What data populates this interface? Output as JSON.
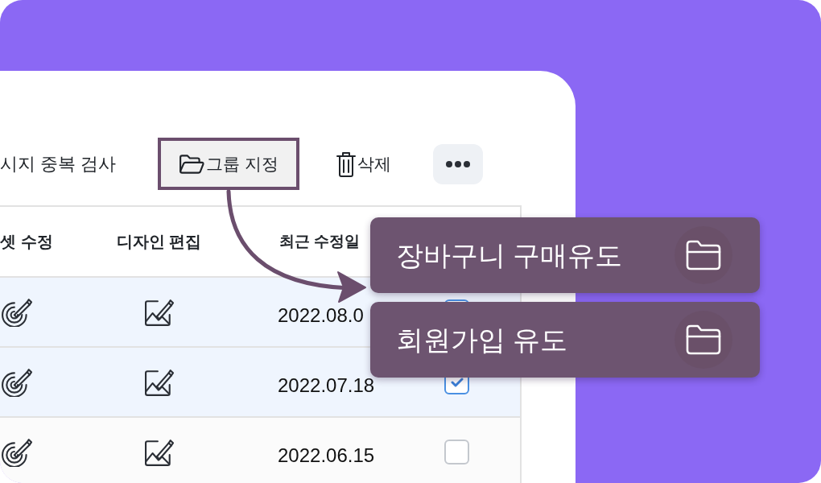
{
  "toolbar": {
    "duplicate_check": {
      "label": "시지 중복 검사"
    },
    "group_button": {
      "label": "그룹 지정",
      "highlighted": true
    },
    "delete_button": {
      "label": "삭제"
    }
  },
  "table": {
    "columns": [
      {
        "label": "셋 수정"
      },
      {
        "label": "디자인 편집"
      },
      {
        "label": "최근 수정일"
      }
    ],
    "rows": [
      {
        "modified": "2022.08.0",
        "selected": true,
        "checked": true
      },
      {
        "modified": "2022.07.18",
        "selected": true,
        "checked": true
      },
      {
        "modified": "2022.06.15",
        "selected": false,
        "checked": false
      }
    ]
  },
  "group_menu": {
    "items": [
      {
        "label": "장바구니 구매유도"
      },
      {
        "label": "회원가입 유도"
      }
    ]
  }
}
